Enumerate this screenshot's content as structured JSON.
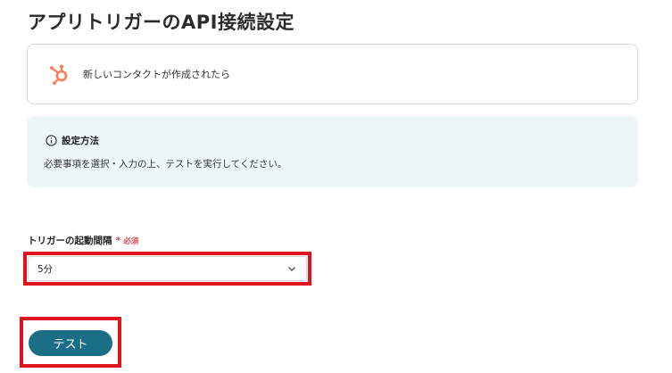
{
  "page": {
    "title": "アプリトリガーのAPI接続設定"
  },
  "trigger": {
    "icon": "hubspot-icon",
    "label": "新しいコンタクトが作成されたら",
    "accent": "#ff7a59"
  },
  "info": {
    "icon": "info-icon",
    "title": "設定方法",
    "text": "必要事項を選択・入力の上、テストを実行してください。"
  },
  "interval_field": {
    "label": "トリガーの起動間隔",
    "required_mark": "*",
    "required_label": "必須",
    "selected_value": "5分"
  },
  "actions": {
    "test_label": "テスト"
  },
  "colors": {
    "button": "#1a6f86",
    "highlight": "#e0141e",
    "required": "#e2474f",
    "info_bg": "#eef7f7"
  }
}
